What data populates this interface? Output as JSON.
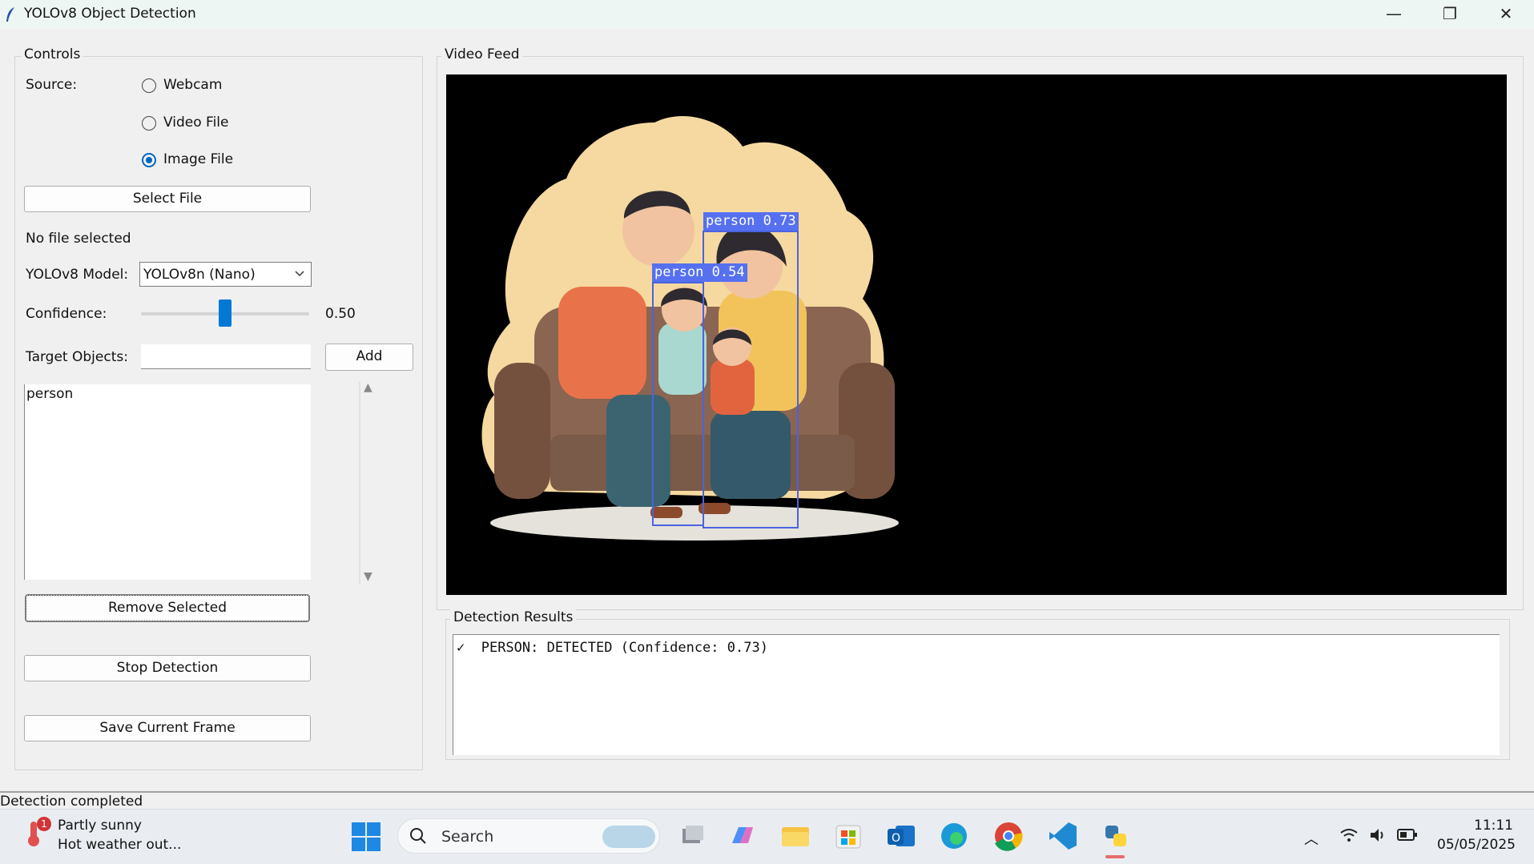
{
  "window": {
    "title": "YOLOv8 Object Detection",
    "minimize_glyph": "—",
    "maximize_glyph": "❐",
    "close_glyph": "✕"
  },
  "controls": {
    "group_label": "Controls",
    "source_label": "Source:",
    "sources": [
      {
        "label": "Webcam",
        "selected": false
      },
      {
        "label": "Video File",
        "selected": false
      },
      {
        "label": "Image File",
        "selected": true
      }
    ],
    "select_file_button": "Select File",
    "file_status": "No file selected",
    "model_label": "YOLOv8 Model:",
    "model_value": "YOLOv8n (Nano)",
    "confidence_label": "Confidence:",
    "confidence_value": "0.50",
    "confidence_fraction": 0.5,
    "target_label": "Target Objects:",
    "target_input_value": "",
    "add_button": "Add",
    "targets": [
      "person"
    ],
    "remove_button": "Remove Selected",
    "stop_button": "Stop Detection",
    "save_button": "Save Current Frame"
  },
  "video": {
    "group_label": "Video Feed",
    "detections": [
      {
        "label": "person 0.73"
      },
      {
        "label": "person 0.54"
      }
    ]
  },
  "results": {
    "group_label": "Detection Results",
    "lines": [
      {
        "check": "✓",
        "text": "PERSON: DETECTED (Confidence: 0.73)"
      }
    ]
  },
  "status_bar": {
    "text": "Detection completed"
  },
  "taskbar": {
    "weather_title": "Partly sunny",
    "weather_sub": "Hot weather out...",
    "weather_badge": "1",
    "search_placeholder": "Search",
    "time": "11:11",
    "date": "05/05/2025"
  },
  "colors": {
    "accent": "#0067c0",
    "box": "#4a63e0",
    "box_label_bg": "#5670f0"
  }
}
